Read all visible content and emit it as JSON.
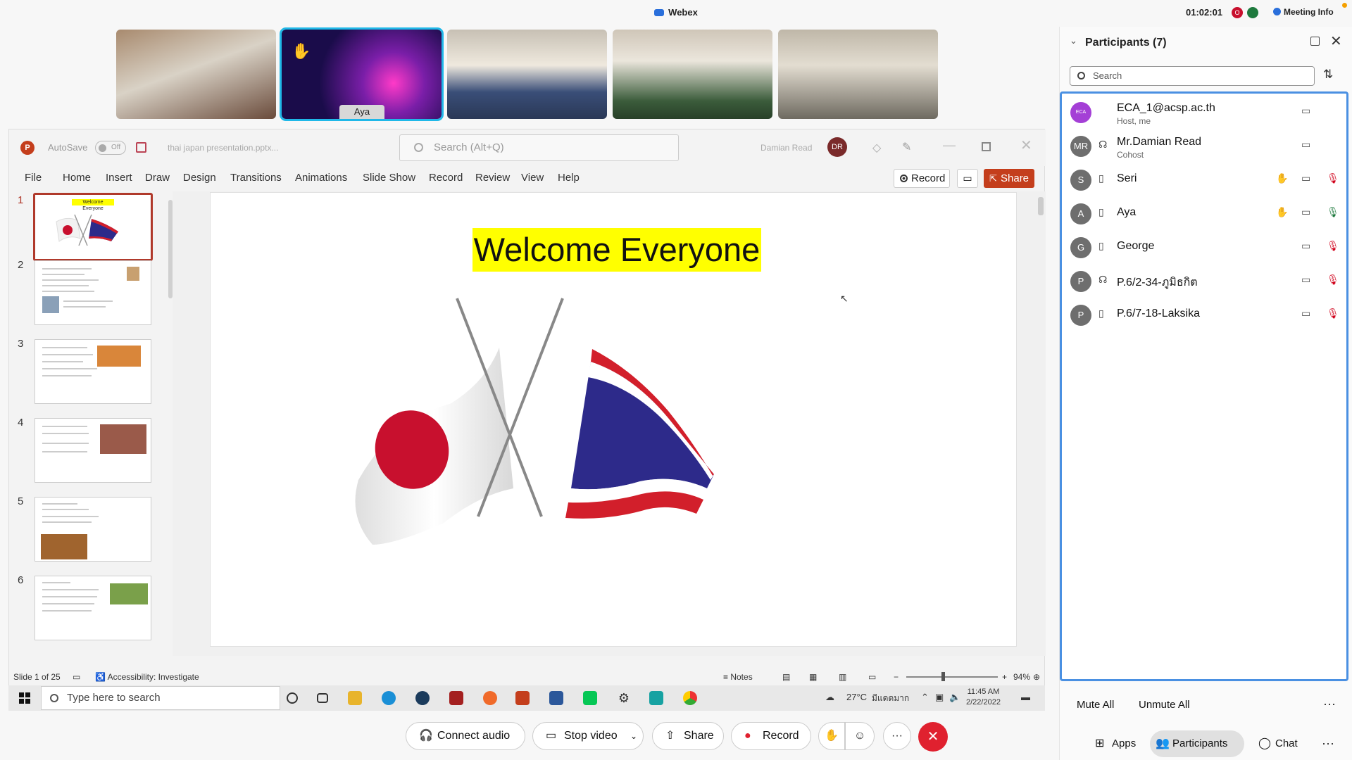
{
  "app": {
    "title": "Webex",
    "timer": "01:02:01",
    "meeting_info": "Meeting Info",
    "rec_icon": "recording-indicator-icon",
    "accent": "#2a6fdb"
  },
  "video_tiles": [
    {
      "label": ""
    },
    {
      "label": "Aya"
    },
    {
      "label": ""
    },
    {
      "label": ""
    },
    {
      "label": ""
    }
  ],
  "ppt": {
    "autosave": "AutoSave",
    "toggle": "Off",
    "filename": "thai japan presentation.pptx...",
    "search_placeholder": "Search (Alt+Q)",
    "user_name": "Damian Read",
    "user_initials": "DR",
    "menu": [
      "File",
      "Home",
      "Insert",
      "Draw",
      "Design",
      "Transitions",
      "Animations",
      "Slide Show",
      "Record",
      "Review",
      "View",
      "Help"
    ],
    "record_btn": "Record",
    "share_btn": "Share",
    "brand_color": "#c43e1c",
    "slide_title": "Welcome Everyone",
    "thumb_title": "Welcome Everyone",
    "thumb_numbers": [
      "1",
      "2",
      "3",
      "4",
      "5",
      "6"
    ],
    "status_slide": "Slide 1 of 25",
    "status_access": "Accessibility: Investigate",
    "notes": "Notes",
    "zoom": "94%"
  },
  "taskbar": {
    "search_placeholder": "Type here to search",
    "temp": "27°C",
    "weather": "มีแดดมาก",
    "time": "11:45 AM",
    "date": "2/22/2022"
  },
  "controls": {
    "connect_audio": "Connect audio",
    "stop_video": "Stop video",
    "share": "Share",
    "record": "Record"
  },
  "participants": {
    "title": "Participants (7)",
    "search_placeholder": "Search",
    "list": [
      {
        "initials": "ECA",
        "name": "ECA_1@acsp.ac.th",
        "role": "Host, me",
        "device": ""
      },
      {
        "initials": "MR",
        "name": "Mr.Damian Read",
        "role": "Cohost",
        "device": "phone-audio-icon"
      },
      {
        "initials": "S",
        "name": "Seri",
        "role": "",
        "device": "mobile-icon"
      },
      {
        "initials": "A",
        "name": "Aya",
        "role": "",
        "device": "mobile-icon"
      },
      {
        "initials": "G",
        "name": "George",
        "role": "",
        "device": "mobile-icon"
      },
      {
        "initials": "P",
        "name": "P.6/2-34-ภูมิธกิต",
        "role": "",
        "device": "phone-audio-icon"
      },
      {
        "initials": "P",
        "name": "P.6/7-18-Laksika",
        "role": "",
        "device": "mobile-icon"
      }
    ],
    "mute_all": "Mute All",
    "unmute_all": "Unmute All",
    "tabs": [
      "Apps",
      "Participants",
      "Chat"
    ]
  }
}
